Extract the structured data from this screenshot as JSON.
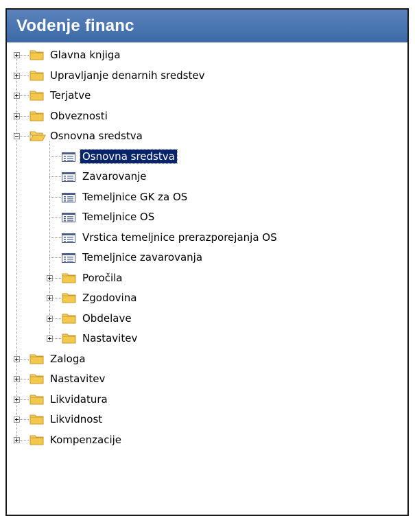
{
  "window": {
    "title": "Vodenje financ"
  },
  "colors": {
    "selection": "#0a246a",
    "titlebar": "#4a74b0",
    "folder": "#f2c94c"
  },
  "tree": [
    {
      "label": "Glavna knjiga",
      "type": "folder",
      "state": "collapsed",
      "level": 0
    },
    {
      "label": "Upravljanje denarnih sredstev",
      "type": "folder",
      "state": "collapsed",
      "level": 0
    },
    {
      "label": "Terjatve",
      "type": "folder",
      "state": "collapsed",
      "level": 0
    },
    {
      "label": "Obveznosti",
      "type": "folder",
      "state": "collapsed",
      "level": 0
    },
    {
      "label": "Osnovna sredstva",
      "type": "folder",
      "state": "expanded",
      "level": 0
    },
    {
      "label": "Osnovna sredstva",
      "type": "form",
      "level": 1,
      "selected": true
    },
    {
      "label": "Zavarovanje",
      "type": "form",
      "level": 1
    },
    {
      "label": "Temeljnice GK za OS",
      "type": "form",
      "level": 1
    },
    {
      "label": "Temeljnice OS",
      "type": "form",
      "level": 1
    },
    {
      "label": "Vrstica temeljnice prerazporejanja OS",
      "type": "form",
      "level": 1
    },
    {
      "label": "Temeljnice zavarovanja",
      "type": "form",
      "level": 1
    },
    {
      "label": "Poročila",
      "type": "folder",
      "state": "collapsed",
      "level": 1
    },
    {
      "label": "Zgodovina",
      "type": "folder",
      "state": "collapsed",
      "level": 1
    },
    {
      "label": "Obdelave",
      "type": "folder",
      "state": "collapsed",
      "level": 1
    },
    {
      "label": "Nastavitev",
      "type": "folder",
      "state": "collapsed",
      "level": 1
    },
    {
      "label": "Zaloga",
      "type": "folder",
      "state": "collapsed",
      "level": 0
    },
    {
      "label": "Nastavitev",
      "type": "folder",
      "state": "collapsed",
      "level": 0
    },
    {
      "label": "Likvidatura",
      "type": "folder",
      "state": "collapsed",
      "level": 0
    },
    {
      "label": "Likvidnost",
      "type": "folder",
      "state": "collapsed",
      "level": 0
    },
    {
      "label": "Kompenzacije",
      "type": "folder",
      "state": "collapsed",
      "level": 0
    }
  ]
}
